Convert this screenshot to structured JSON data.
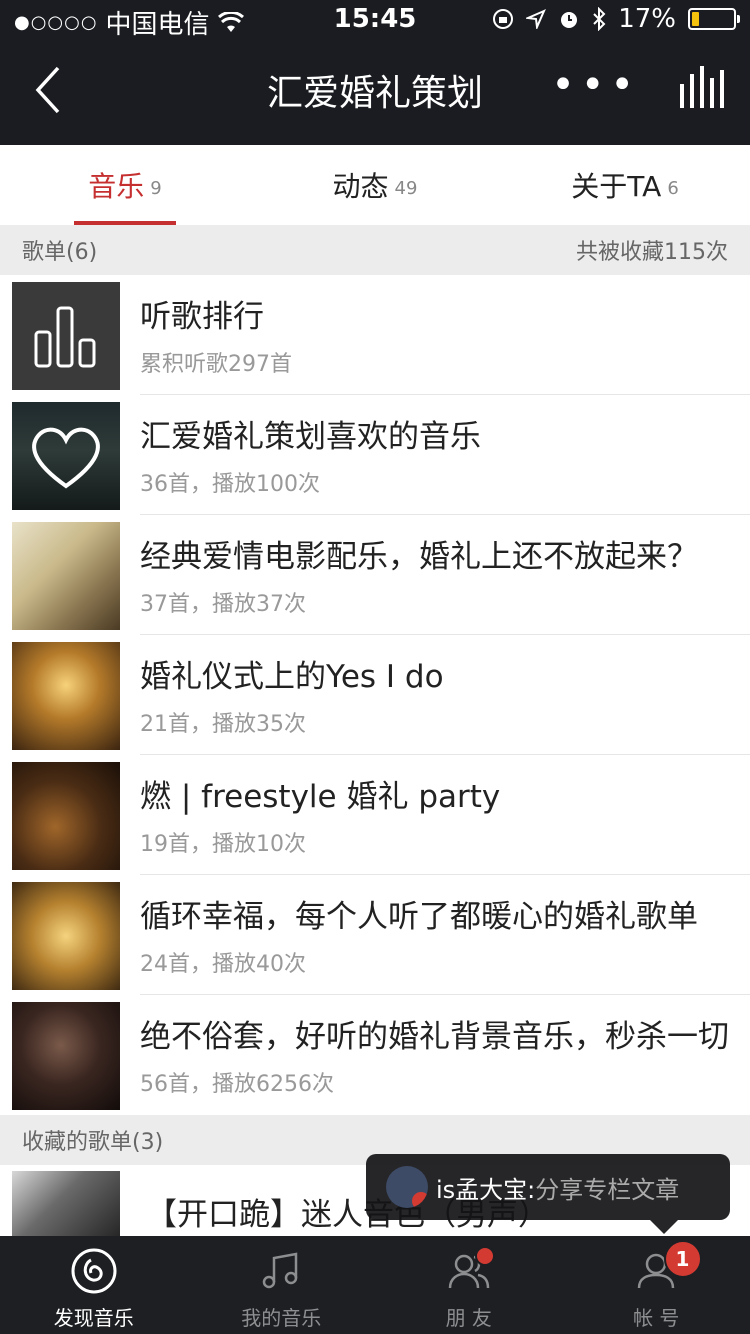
{
  "status": {
    "carrier": "中国电信",
    "time": "15:45",
    "battery": "17%",
    "battery_level": 0.17
  },
  "nav": {
    "title": "汇爱婚礼策划"
  },
  "tabs": [
    {
      "label": "音乐",
      "count": "9"
    },
    {
      "label": "动态",
      "count": "49"
    },
    {
      "label": "关于TA",
      "count": "6"
    }
  ],
  "playlists_section": {
    "title": "歌单(6)",
    "summary": "共被收藏115次"
  },
  "playlists": [
    {
      "name": "听歌排行",
      "meta": "累积听歌297首"
    },
    {
      "name": "汇爱婚礼策划喜欢的音乐",
      "meta": "36首，播放100次"
    },
    {
      "name": "经典爱情电影配乐，婚礼上还不放起来？",
      "meta": "37首，播放37次"
    },
    {
      "name": "婚礼仪式上的Yes I do",
      "meta": "21首，播放35次"
    },
    {
      "name": "燃 | freestyle 婚礼 party",
      "meta": "19首，播放10次"
    },
    {
      "name": "循环幸福，每个人听了都暖心的婚礼歌单",
      "meta": "24首，播放40次"
    },
    {
      "name": "绝不俗套，好听的婚礼背景音乐，秒杀一切",
      "meta": "56首，播放6256次"
    }
  ],
  "collected_section": {
    "title": "收藏的歌单(3)"
  },
  "collected": [
    {
      "name": "【开口跪】迷人音色（男声）"
    }
  ],
  "toast": {
    "user": "is孟大宝:",
    "message": " 分享专栏文章"
  },
  "tabbar": [
    {
      "label": "发现音乐"
    },
    {
      "label": "我的音乐"
    },
    {
      "label": "朋 友"
    },
    {
      "label": "帐 号",
      "badge": "1"
    }
  ]
}
